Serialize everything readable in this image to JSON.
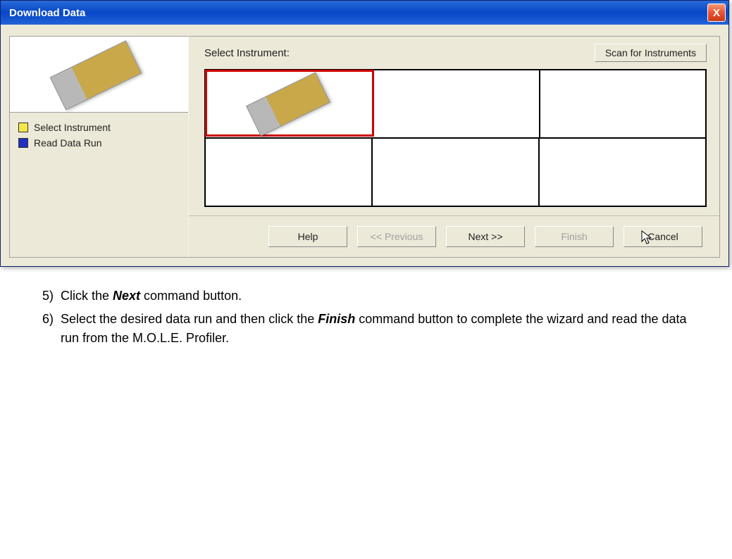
{
  "titlebar": {
    "title": "Download Data",
    "close_label": "X"
  },
  "sidebar": {
    "steps": [
      {
        "color": "yellow",
        "label": "Select Instrument"
      },
      {
        "color": "blue",
        "label": "Read Data Run"
      }
    ]
  },
  "main": {
    "header_label": "Select Instrument:",
    "scan_label": "Scan for Instruments"
  },
  "buttons": {
    "help": "Help",
    "prev": "<< Previous",
    "next": "Next >>",
    "finish": "Finish",
    "cancel": "Cancel"
  },
  "instructions": {
    "items": [
      {
        "num": "5)",
        "prefix": "Click the ",
        "bold": "Next",
        "suffix": " command button."
      },
      {
        "num": "6)",
        "prefix": "Select the desired data run and then click the ",
        "bold": "Finish",
        "suffix": " command button to complete the wizard and read the data run from the M.O.L.E. Profiler."
      }
    ]
  }
}
